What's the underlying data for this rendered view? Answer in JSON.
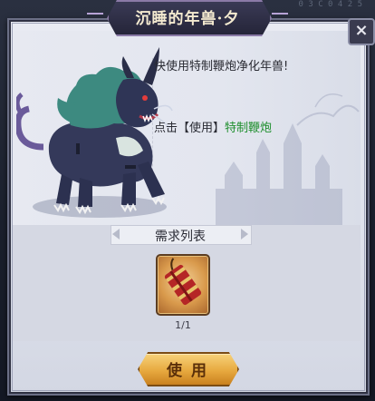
{
  "dialog": {
    "title": "沉睡的年兽·夕",
    "close_symbol": "×",
    "description": "快使用特制鞭炮净化年兽!",
    "hint_prefix": "点击【使用】",
    "hint_item": "特制鞭炮"
  },
  "requirements": {
    "title": "需求列表",
    "item": {
      "name": "特制鞭炮",
      "count_text": "1/1",
      "icon": "firecracker-icon"
    }
  },
  "actions": {
    "use_label": "使用"
  },
  "icons": {
    "close": "close-icon",
    "creature": "nian-beast-illustration"
  },
  "colors": {
    "highlight_green": "#1f8f2e",
    "button_gold": "#e7a93f",
    "title_bar": "#2f3047"
  }
}
